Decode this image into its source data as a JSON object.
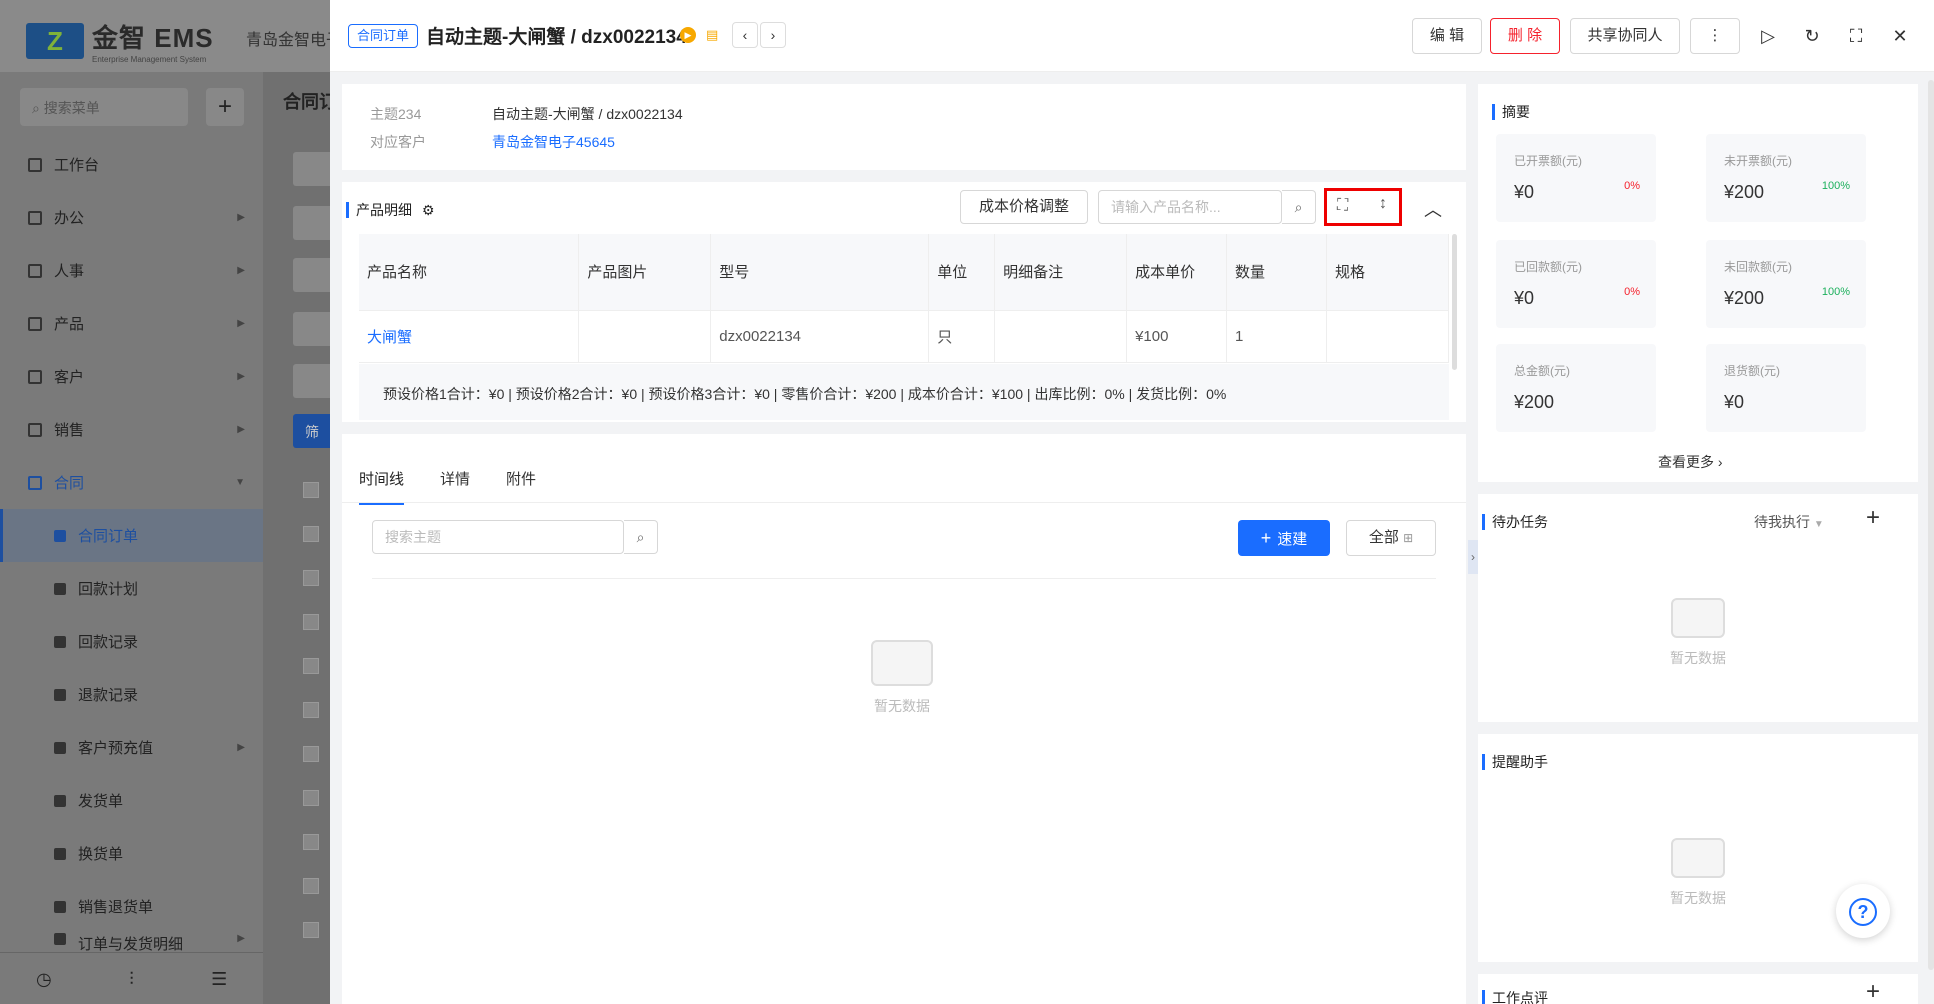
{
  "app": {
    "brand": "金智 EMS",
    "brand_sub": "Enterprise Management System",
    "company": "青岛金智电子"
  },
  "sidebar": {
    "search_placeholder": "搜索菜单",
    "items": [
      {
        "label": "工作台"
      },
      {
        "label": "办公"
      },
      {
        "label": "人事"
      },
      {
        "label": "产品"
      },
      {
        "label": "客户"
      },
      {
        "label": "销售"
      },
      {
        "label": "合同"
      },
      {
        "label": "合同订单"
      },
      {
        "label": "回款计划"
      },
      {
        "label": "回款记录"
      },
      {
        "label": "退款记录"
      },
      {
        "label": "客户预充值"
      },
      {
        "label": "发货单"
      },
      {
        "label": "换货单"
      },
      {
        "label": "销售退货单"
      },
      {
        "label": "订单与发货明细"
      }
    ]
  },
  "bg_main": {
    "title": "合同订",
    "filter_btn": "筛"
  },
  "drawer": {
    "tag": "合同订单",
    "title": "自动主题-大闸蟹 / dzx0022134",
    "buttons": {
      "edit": "编 辑",
      "delete": "删 除",
      "share": "共享协同人",
      "more": "⋮"
    },
    "info": [
      {
        "key": "主题234",
        "value": "自动主题-大闸蟹 / dzx0022134"
      },
      {
        "key": "对应客户",
        "value": "青岛金智电子45645"
      }
    ],
    "products": {
      "title": "产品明细",
      "cost_btn": "成本价格调整",
      "search_placeholder": "请输入产品名称...",
      "columns": [
        "产品名称",
        "产品图片",
        "型号",
        "单位",
        "明细备注",
        "成本单价",
        "数量",
        "规格"
      ],
      "rows": [
        [
          "大闸蟹",
          "",
          "dzx0022134",
          "只",
          "",
          "¥100",
          "1",
          ""
        ]
      ],
      "summary": "预设价格1合计：¥0 |   预设价格2合计：¥0 |   预设价格3合计：¥0 |   零售价合计：¥200 |   成本价合计：¥100 |   出库比例：0% |   发货比例：0%"
    },
    "tabs": [
      "时间线",
      "详情",
      "附件"
    ],
    "timeline": {
      "search_placeholder": "搜索主题",
      "quick_btn": "速建",
      "all_btn": "全部",
      "empty": "暂无数据"
    }
  },
  "summary": {
    "title": "摘要",
    "stats": [
      {
        "label": "已开票额(元)",
        "value": "¥0",
        "pct": "0%"
      },
      {
        "label": "未开票额(元)",
        "value": "¥200",
        "pct": "100%"
      },
      {
        "label": "已回款额(元)",
        "value": "¥0",
        "pct": "0%"
      },
      {
        "label": "未回款额(元)",
        "value": "¥200",
        "pct": "100%"
      },
      {
        "label": "总金额(元)",
        "value": "¥200",
        "pct": ""
      },
      {
        "label": "退货额(元)",
        "value": "¥0",
        "pct": ""
      }
    ],
    "more": "查看更多"
  },
  "todo": {
    "title": "待办任务",
    "filter": "待我执行",
    "empty": "暂无数据"
  },
  "reminder": {
    "title": "提醒助手",
    "empty": "暂无数据"
  },
  "review": {
    "title": "工作点评"
  },
  "colors": {
    "primary": "#1a6dff",
    "danger": "#f5222d",
    "success": "#1cb05c",
    "star": "#f7a800"
  }
}
